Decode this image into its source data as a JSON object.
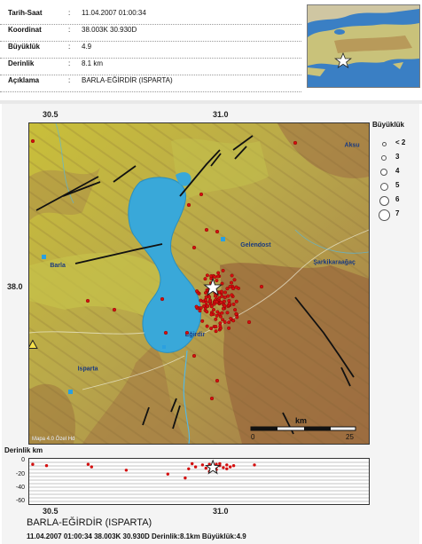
{
  "info": {
    "rows": [
      {
        "key": "Tarih-Saat",
        "value": "11.04.2007 01:00:34"
      },
      {
        "key": "Koordinat",
        "value": "38.003K 30.930D"
      },
      {
        "key": "Büyüklük",
        "value": "4.9"
      },
      {
        "key": "Derinlik",
        "value": "8.1 km"
      },
      {
        "key": "Açıklama",
        "value": "BARLA-EĞİRDİR (ISPARTA)"
      }
    ]
  },
  "map": {
    "lon_ticks": [
      "30.5",
      "31.0"
    ],
    "lat_tick": "38.0",
    "lon_range": [
      30.4,
      31.38
    ],
    "lat_range": [
      37.55,
      38.48
    ],
    "places": [
      {
        "name": "Barla",
        "lon": 30.47,
        "lat": 38.07
      },
      {
        "name": "Gelendost",
        "lon": 31.02,
        "lat": 38.13
      },
      {
        "name": "Eğirdir",
        "lon": 30.86,
        "lat": 37.87
      },
      {
        "name": "Isparta",
        "lon": 30.55,
        "lat": 37.77
      },
      {
        "name": "Şarkikaraağaç",
        "lon": 31.23,
        "lat": 38.08
      },
      {
        "name": "Aksu",
        "lon": 31.32,
        "lat": 38.42
      }
    ],
    "scale": {
      "unit": "km",
      "start": "0",
      "end": "25"
    },
    "credit": "Mapa 4.0 Özel Hd",
    "epicenter": {
      "lon": 30.93,
      "lat": 38.003
    },
    "station": {
      "lon": 30.41,
      "lat": 37.85
    },
    "colors": {
      "lake": "#39a8d9",
      "event": "#d40f0f",
      "fault": "#111111",
      "lowland": "#c9c23c",
      "highland": "#9b6a3d"
    }
  },
  "legend": {
    "title": "Büyüklük",
    "items": [
      {
        "label": "< 2",
        "size": 3
      },
      {
        "label": "3",
        "size": 4
      },
      {
        "label": "4",
        "size": 6
      },
      {
        "label": "5",
        "size": 7
      },
      {
        "label": "6",
        "size": 9
      },
      {
        "label": "7",
        "size": 11
      }
    ]
  },
  "depth": {
    "title": "Derinlik km",
    "ticks": [
      "0",
      "-20",
      "-40",
      "-60"
    ],
    "lon_ticks": [
      "30.5",
      "31.0"
    ],
    "events": [
      {
        "lon": 30.41,
        "depth": 3
      },
      {
        "lon": 30.45,
        "depth": 5
      },
      {
        "lon": 30.57,
        "depth": 3
      },
      {
        "lon": 30.58,
        "depth": 7
      },
      {
        "lon": 30.68,
        "depth": 12
      },
      {
        "lon": 30.85,
        "depth": 24
      },
      {
        "lon": 30.86,
        "depth": 10
      },
      {
        "lon": 30.87,
        "depth": 2
      },
      {
        "lon": 30.88,
        "depth": 7
      },
      {
        "lon": 30.9,
        "depth": 4
      },
      {
        "lon": 30.91,
        "depth": 9
      },
      {
        "lon": 30.92,
        "depth": 3
      },
      {
        "lon": 30.93,
        "depth": 6
      },
      {
        "lon": 30.94,
        "depth": 11
      },
      {
        "lon": 30.95,
        "depth": 5
      },
      {
        "lon": 30.96,
        "depth": 8
      },
      {
        "lon": 30.97,
        "depth": 4
      },
      {
        "lon": 30.98,
        "depth": 7
      },
      {
        "lon": 30.95,
        "depth": 2
      },
      {
        "lon": 30.97,
        "depth": 10
      },
      {
        "lon": 30.99,
        "depth": 5
      },
      {
        "lon": 30.92,
        "depth": 14
      },
      {
        "lon": 30.94,
        "depth": 3
      },
      {
        "lon": 31.05,
        "depth": 4
      },
      {
        "lon": 30.8,
        "depth": 18
      }
    ]
  },
  "caption": {
    "title": "BARLA-EĞİRDİR (ISPARTA)",
    "subtitle": "11.04.2007 01:00:34  38.003K 30.930D  Derinlik:8.1km  Büyüklük:4.9"
  }
}
